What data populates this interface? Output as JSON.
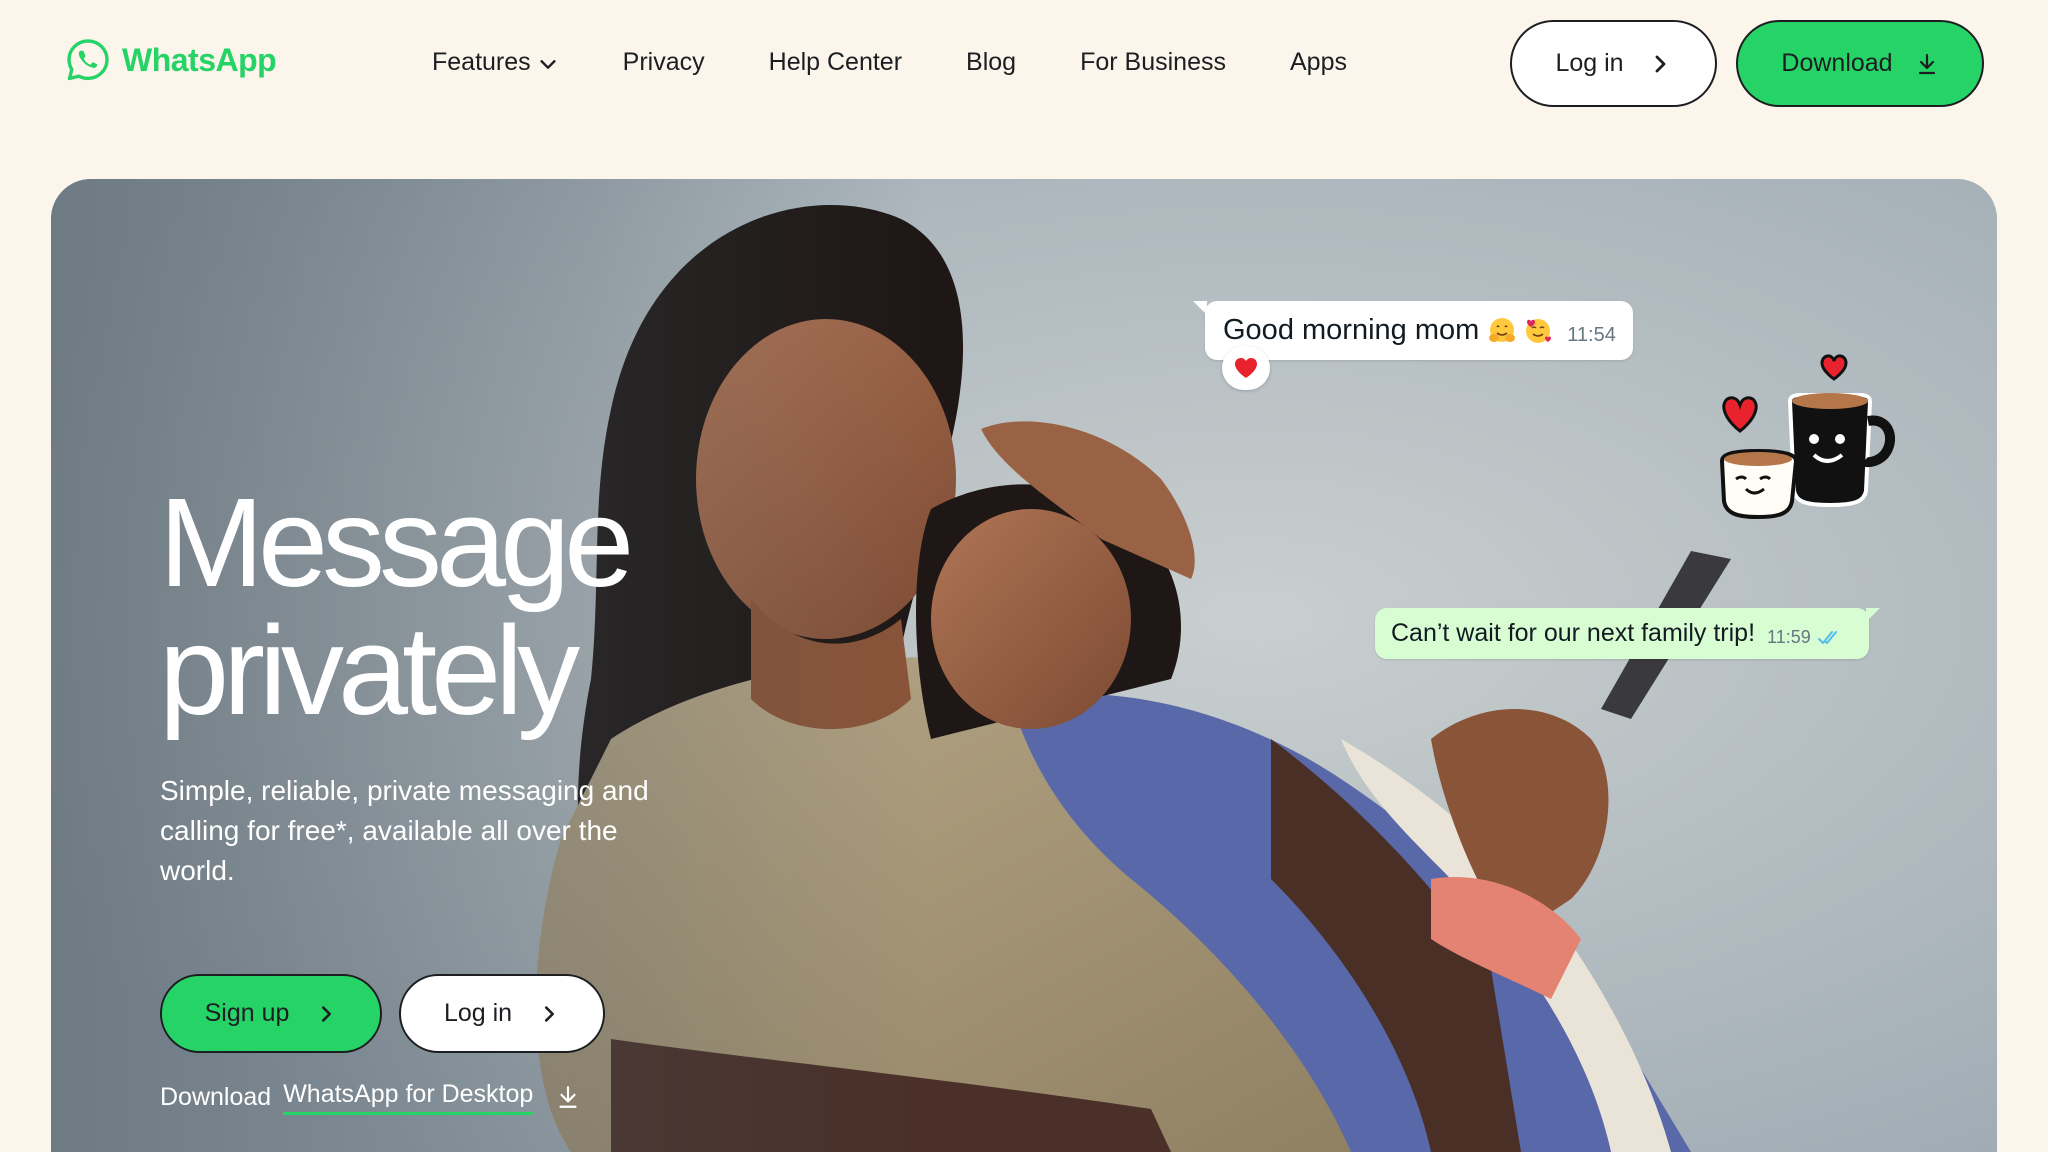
{
  "brand": {
    "name": "WhatsApp",
    "color": "#25D366",
    "icon": "whatsapp-logo-icon"
  },
  "nav": {
    "items": [
      {
        "label": "Features",
        "icon": "chevron-down-icon"
      },
      {
        "label": "Privacy"
      },
      {
        "label": "Help Center"
      },
      {
        "label": "Blog"
      },
      {
        "label": "For Business"
      },
      {
        "label": "Apps"
      }
    ]
  },
  "header_actions": {
    "login_label": "Log in",
    "login_icon": "chevron-right-icon",
    "download_label": "Download",
    "download_icon": "download-icon"
  },
  "hero": {
    "title_line1": "Message",
    "title_line2": "privately",
    "subtitle": "Simple, reliable, private messaging and calling for free*, available all over the world.",
    "signup_label": "Sign up",
    "login_label": "Log in",
    "desktop_prefix": "Download",
    "desktop_link": "WhatsApp for Desktop",
    "desktop_icon": "download-icon"
  },
  "chat": {
    "incoming": {
      "text": "Good morning mom",
      "emojis": [
        "hugging-face-emoji",
        "smiling-face-with-hearts-emoji"
      ],
      "time": "11:54",
      "reaction": "red-heart-emoji"
    },
    "outgoing": {
      "text": "Can’t wait for our next family trip!",
      "time": "11:59",
      "status": "read-double-check-icon"
    },
    "sticker": "coffee-cups-with-hearts-sticker"
  },
  "colors": {
    "page_bg": "#FCF5EB",
    "accent": "#25D366",
    "outgoing_bubble": "#D9FDD3",
    "read_tick": "#53BDEB",
    "text": "#1C1E21"
  }
}
